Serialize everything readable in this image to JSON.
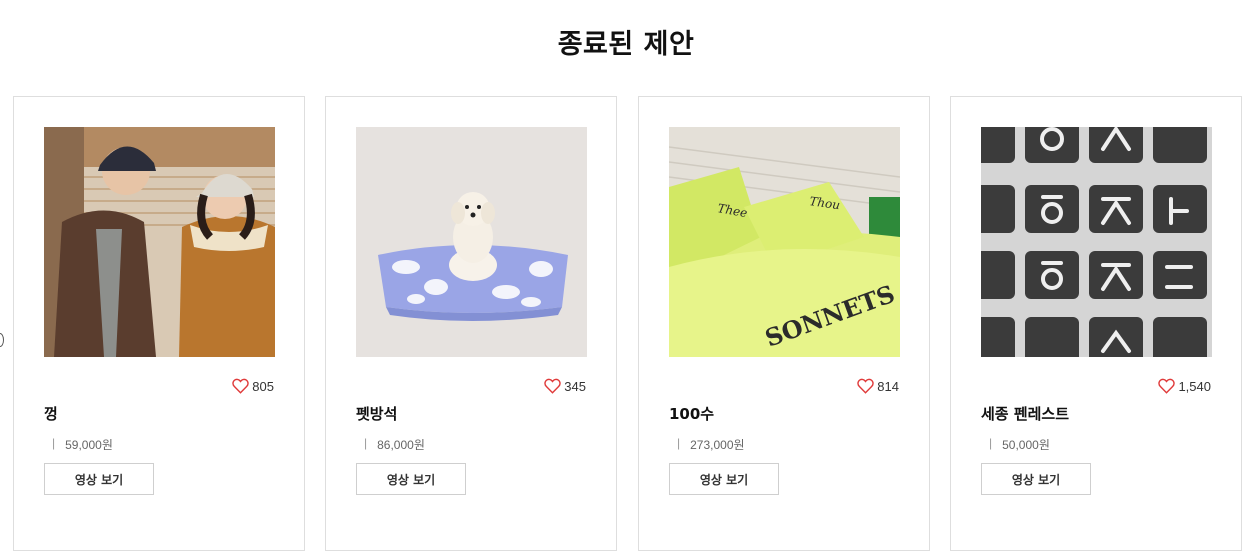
{
  "section": {
    "title": "종료된 제안"
  },
  "colors": {
    "heart": "#e03a3a",
    "border": "#dedede"
  },
  "products": [
    {
      "name": "껑",
      "likes": "805",
      "price": "59,000원",
      "button_label": "영상 보기",
      "image": "couple-in-winter-jackets-photo"
    },
    {
      "name": "펫방석",
      "likes": "345",
      "price": "86,000원",
      "button_label": "영상 보기",
      "image": "dog-on-pet-cushion-photo"
    },
    {
      "name": "100수",
      "likes": "814",
      "price": "273,000원",
      "button_label": "영상 보기",
      "image": "lime-bedding-set-photo"
    },
    {
      "name": "세종 펜레스트",
      "likes": "1,540",
      "price": "50,000원",
      "button_label": "영상 보기",
      "image": "hangul-keycaps-photo"
    }
  ]
}
